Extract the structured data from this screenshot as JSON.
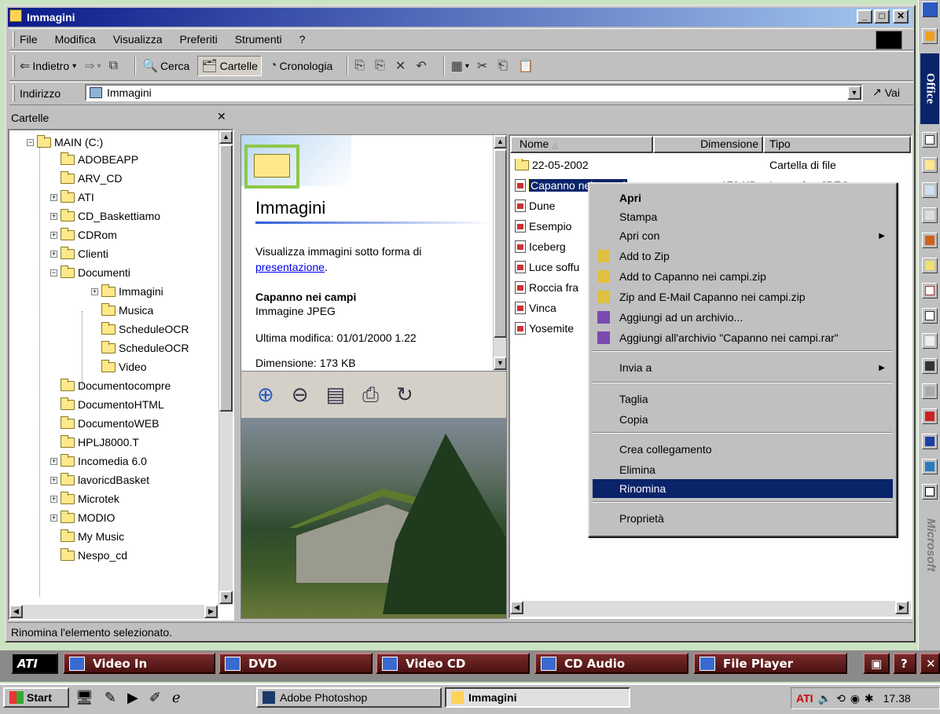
{
  "window": {
    "title": "Immagini"
  },
  "menu": [
    "File",
    "Modifica",
    "Visualizza",
    "Preferiti",
    "Strumenti",
    "?"
  ],
  "toolbar": {
    "back": "Indietro",
    "search": "Cerca",
    "folders": "Cartelle",
    "history": "Cronologia"
  },
  "address": {
    "label": "Indirizzo",
    "value": "Immagini",
    "go": "Vai"
  },
  "tree": {
    "header": "Cartelle",
    "root": "MAIN (C:)",
    "items": [
      "ADOBEAPP",
      "ARV_CD",
      "ATI",
      "CD_Baskettiamo",
      "CDRom",
      "Clienti",
      "Documenti",
      "Immagini",
      "Musica",
      "ScheduleOCR",
      "ScheduleOCR",
      "Video",
      "Documentocompre",
      "DocumentoHTML",
      "DocumentoWEB",
      "HPLJ8000.T",
      "Incomedia 6.0",
      "lavoricdBasket",
      "Microtek",
      "MODIO",
      "My Music",
      "Nespo_cd"
    ]
  },
  "preview": {
    "folder_title": "Immagini",
    "desc": "Visualizza immagini sotto forma di",
    "link": "presentazione",
    "link_suffix": ".",
    "file_name": "Capanno nei campi",
    "file_type": "Immagine JPEG",
    "modified": "Ultima modifica: 01/01/2000 1.22",
    "size": "Dimensione: 173 KB"
  },
  "list": {
    "columns": [
      "Nome",
      "Dimensione",
      "Tipo"
    ],
    "rows": [
      {
        "name": "22-05-2002",
        "size": "",
        "type": "Cartella di file"
      },
      {
        "name": "Capanno nei campi",
        "size": "173 KB",
        "type": "Immagine JPEG"
      },
      {
        "name": "Dune",
        "size": "",
        "type": ""
      },
      {
        "name": "Esempio",
        "size": "",
        "type": ""
      },
      {
        "name": "Iceberg",
        "size": "",
        "type": ""
      },
      {
        "name": "Luce soffu",
        "size": "",
        "type": ""
      },
      {
        "name": "Roccia fra",
        "size": "",
        "type": ""
      },
      {
        "name": "Vinca",
        "size": "",
        "type": ""
      },
      {
        "name": "Yosemite",
        "size": "",
        "type": ""
      }
    ]
  },
  "context_menu": [
    "Apri",
    "Stampa",
    "Apri con",
    "Add to Zip",
    "Add to Capanno nei campi.zip",
    "Zip and E-Mail Capanno nei campi.zip",
    "Aggiungi ad un archivio...",
    "Aggiungi all'archivio \"Capanno nei campi.rar\"",
    "Invia a",
    "Taglia",
    "Copia",
    "Crea collegamento",
    "Elimina",
    "Rinomina",
    "Proprietà"
  ],
  "status": "Rinomina l'elemento selezionato.",
  "media_bar": [
    "Video In",
    "DVD",
    "Video CD",
    "CD Audio",
    "File Player"
  ],
  "taskbar": {
    "start": "Start",
    "apps": [
      "Adobe Photoshop",
      "Immagini"
    ],
    "clock": "17.38"
  },
  "office_bar": {
    "label": "Office",
    "brand": "Microsoft"
  }
}
